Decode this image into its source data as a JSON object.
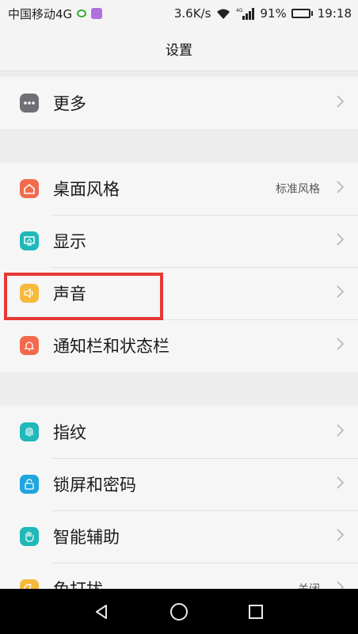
{
  "status_bar": {
    "carrier": "中国移动4G",
    "speed": "3.6K/s",
    "network": "4G",
    "battery": "91%",
    "time": "19:18",
    "battery_level": 0.91
  },
  "title": "设置",
  "groups": [
    {
      "items": [
        {
          "label": "更多",
          "value": "",
          "icon": "more-dots-icon",
          "color": "#6f7075"
        }
      ]
    },
    {
      "items": [
        {
          "label": "桌面风格",
          "value": "标准风格",
          "icon": "home-icon",
          "color": "#f26a4b"
        },
        {
          "label": "显示",
          "value": "",
          "icon": "display-icon",
          "color": "#20b8b8"
        },
        {
          "label": "声音",
          "value": "",
          "icon": "speaker-icon",
          "color": "#f6b93b"
        },
        {
          "label": "通知栏和状态栏",
          "value": "",
          "icon": "bell-icon",
          "color": "#f26a4b"
        }
      ]
    },
    {
      "items": [
        {
          "label": "指纹",
          "value": "",
          "icon": "fingerprint-icon",
          "color": "#20b8b8"
        },
        {
          "label": "锁屏和密码",
          "value": "",
          "icon": "lock-icon",
          "color": "#1fa5e0"
        },
        {
          "label": "智能辅助",
          "value": "",
          "icon": "hand-icon",
          "color": "#20b8b8"
        },
        {
          "label": "免打扰",
          "value": "关闭",
          "icon": "moon-icon",
          "color": "#f6b93b"
        }
      ]
    }
  ],
  "navigation": [
    "back",
    "home",
    "recents"
  ]
}
